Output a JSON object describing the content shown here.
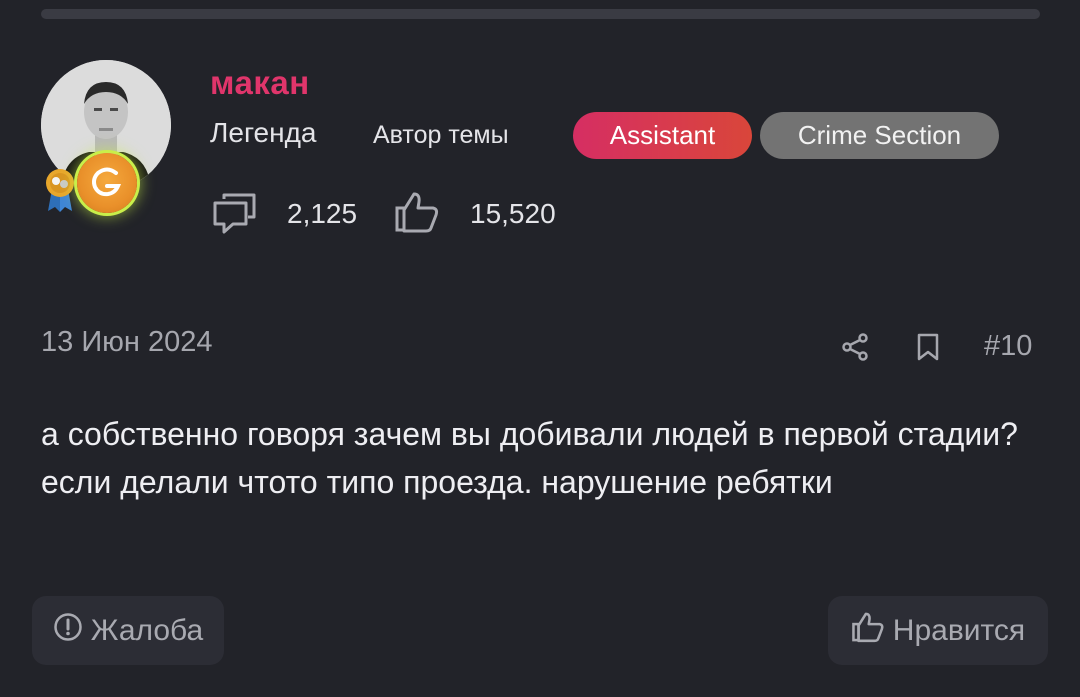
{
  "user": {
    "name": "макан",
    "rank": "Легенда",
    "author_label": "Автор темы",
    "tags": [
      "Assistant",
      "Crime Section"
    ],
    "messages_count": "2,125",
    "likes_count": "15,520"
  },
  "post": {
    "date": "13 Июн 2024",
    "number": "#10",
    "text": "а собственно говоря зачем вы добивали людей в первой стадии? если делали чтото типо проезда. нарушение ребятки"
  },
  "actions": {
    "report_label": "Жалоба",
    "like_label": "Нравится"
  },
  "icons": {
    "messages": "speech-bubbles-icon",
    "likes": "thumbs-up-icon",
    "share": "share-icon",
    "bookmark": "bookmark-icon",
    "report": "exclamation-circle-icon"
  },
  "colors": {
    "background": "#222329",
    "username": "#e0356b",
    "assistant_tag": "#d62e63",
    "crime_tag": "#737373",
    "muted_text": "#a6a7ae"
  }
}
